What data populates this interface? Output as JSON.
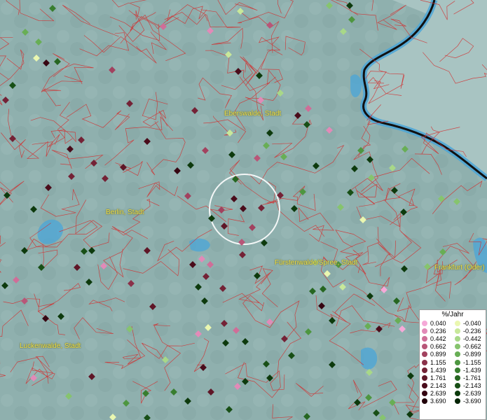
{
  "places": {
    "eberswalde": "Eberswalde, Stadt",
    "berlin": "Berlin, Stadt",
    "fuerstenwalde": "Fürstenwalde/Spree, Stadt",
    "frankfurt": "Frankfurt (Oder)",
    "luckenwalde": "Luckenwalde, Stadt"
  },
  "legend": {
    "title": "%/Jahr",
    "positive": [
      {
        "label": "0.040",
        "color": "#f5a9d8"
      },
      {
        "label": "0.236",
        "color": "#e28ab8"
      },
      {
        "label": "0.442",
        "color": "#cf6e98"
      },
      {
        "label": "0.662",
        "color": "#b85678"
      },
      {
        "label": "0.899",
        "color": "#a2425f"
      },
      {
        "label": "1.155",
        "color": "#8a3149"
      },
      {
        "label": "1.439",
        "color": "#742236"
      },
      {
        "label": "1.761",
        "color": "#5f1627"
      },
      {
        "label": "2.143",
        "color": "#4a0c1b"
      },
      {
        "label": "2.639",
        "color": "#360612"
      },
      {
        "label": "3.690",
        "color": "#22020a"
      }
    ],
    "negative": [
      {
        "label": "-0.040",
        "color": "#eaf7b0"
      },
      {
        "label": "-0.236",
        "color": "#c8e89a"
      },
      {
        "label": "-0.442",
        "color": "#a8d888"
      },
      {
        "label": "-0.662",
        "color": "#86c46e"
      },
      {
        "label": "-0.899",
        "color": "#68ae55"
      },
      {
        "label": "-1.155",
        "color": "#4e9640"
      },
      {
        "label": "-1.439",
        "color": "#387e2f"
      },
      {
        "label": "-1.761",
        "color": "#266621"
      },
      {
        "label": "-2.143",
        "color": "#184f16"
      },
      {
        "label": "-2.639",
        "color": "#0d3a0d"
      },
      {
        "label": "-3.690",
        "color": "#052405"
      }
    ]
  }
}
